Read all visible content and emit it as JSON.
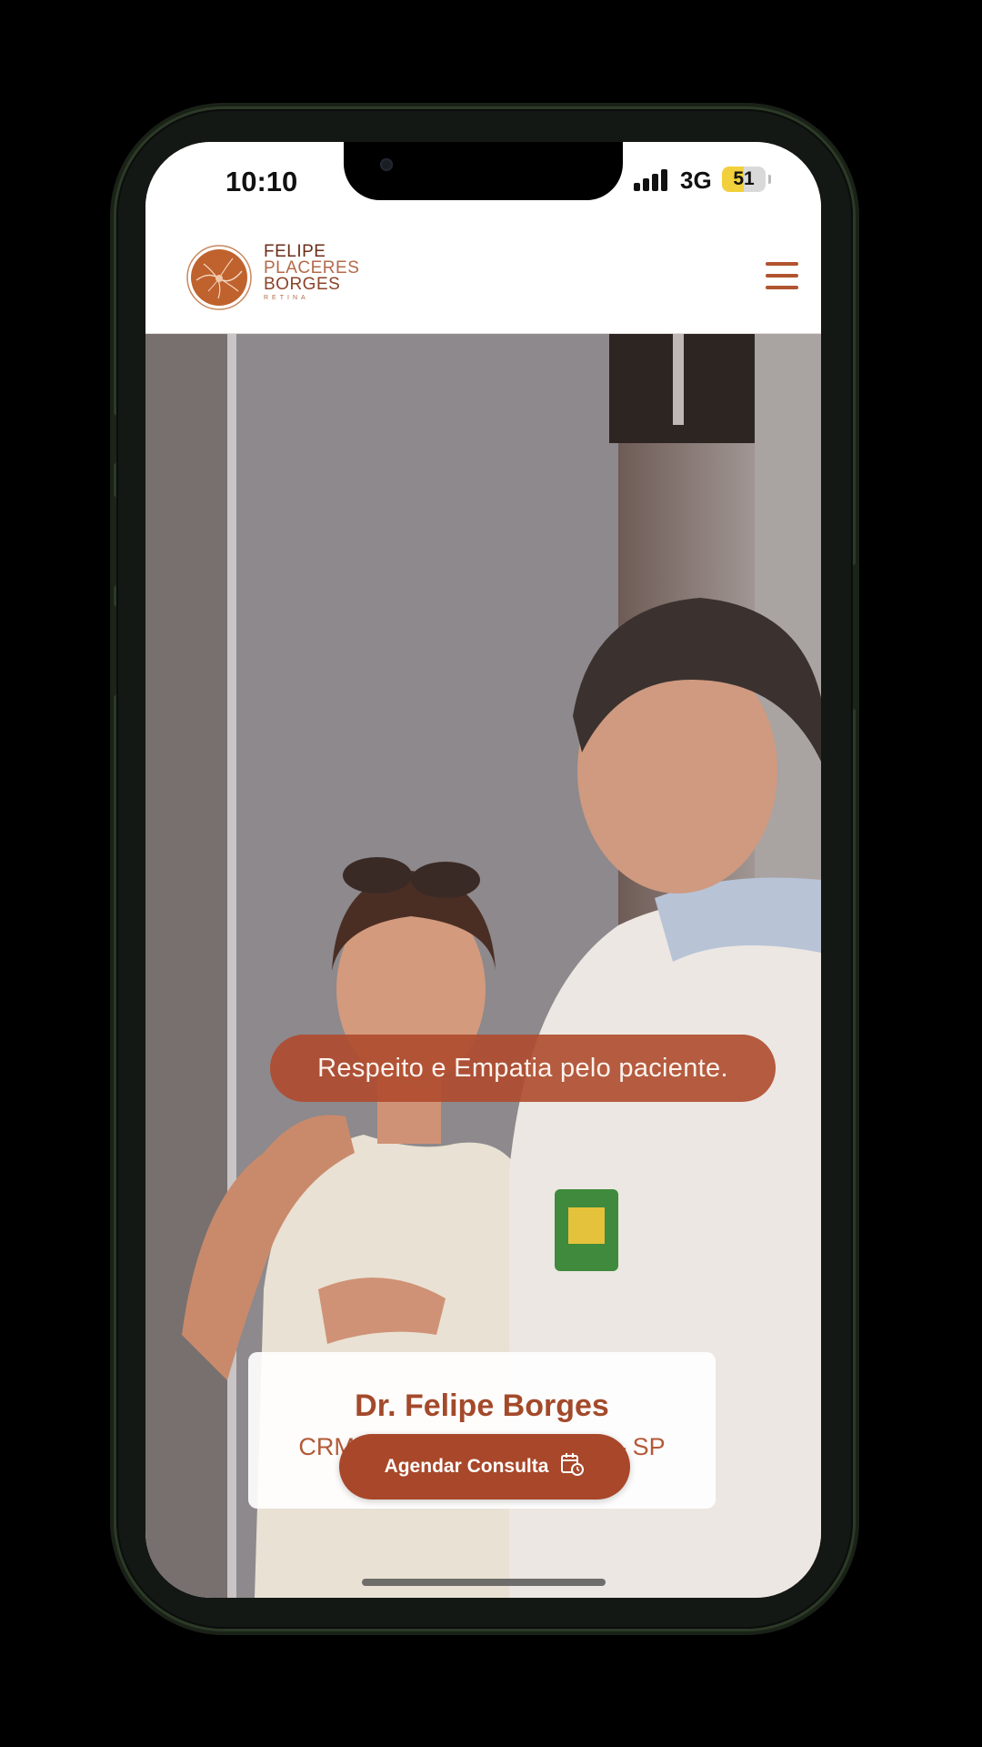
{
  "status_bar": {
    "time": "10:10",
    "network": "3G",
    "battery": "51",
    "battery_level": 0.51
  },
  "header": {
    "logo": {
      "line1": "FELIPE",
      "line2": "PLACERES",
      "line3": "BORGES",
      "tagline": "RETINA"
    },
    "menu_icon": "hamburger-icon"
  },
  "hero": {
    "caption": "Respeito e Empatia pelo paciente.",
    "doctor_name": "Dr. Felipe Borges",
    "registration": "CRM 144.649 | RQE 55.422 – SP",
    "cta_label": "Agendar Consulta",
    "cta_icon": "calendar-clock-icon"
  },
  "colors": {
    "brand": "#a8472a",
    "brand_light": "#b36a4a",
    "battery": "#f2d03b"
  }
}
